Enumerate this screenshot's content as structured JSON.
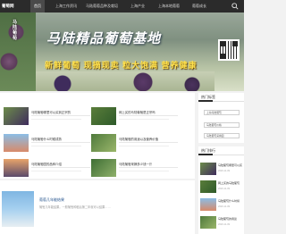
{
  "nav": {
    "logo": "葡萄网",
    "items": [
      "首页",
      "上海工作资讯",
      "马陆葡萄品种及栽培",
      "上海产业",
      "上海本地葡萄",
      "葡萄成长"
    ]
  },
  "banner": {
    "title": "马陆精品葡萄基地",
    "subtitle": "新鲜葡萄 现摘现卖 粒大饱满 营养健康",
    "vertical_text": "马陆葡萄"
  },
  "articles": [
    {
      "title": "马陆葡萄哪里可以买到正宗的"
    },
    {
      "title": "网上买的马陆葡萄是正宗吗"
    },
    {
      "title": "马陆葡萄什么时候成熟"
    },
    {
      "title": "马陆葡萄的用途以及营养价值"
    },
    {
      "title": "马陆葡萄园的品种介绍"
    },
    {
      "title": "马陆葡萄采摘多少钱一斤"
    }
  ],
  "featured": {
    "title": "葡萄几年能结果",
    "desc": "葡萄几年能结果，一般葡萄种植后第二年就可以结果……"
  },
  "sidebar": {
    "tags_title": "热门标签",
    "tags": [
      "上海马陆葡萄",
      "马陆葡萄价格",
      "马陆葡萄采摘园"
    ],
    "hot_title": "热门排行",
    "hot": [
      {
        "title": "马陆葡萄哪里可以买",
        "date": "2020-11-09"
      },
      {
        "title": "网上买的马陆葡萄",
        "date": "2020-11-09"
      },
      {
        "title": "马陆葡萄什么时候",
        "date": "2020-11-09"
      },
      {
        "title": "马陆葡萄的用途",
        "date": "2020-11-09"
      }
    ]
  },
  "colors": {
    "nav_bg": "#2b2b2b",
    "link": "#1f4f8a"
  }
}
